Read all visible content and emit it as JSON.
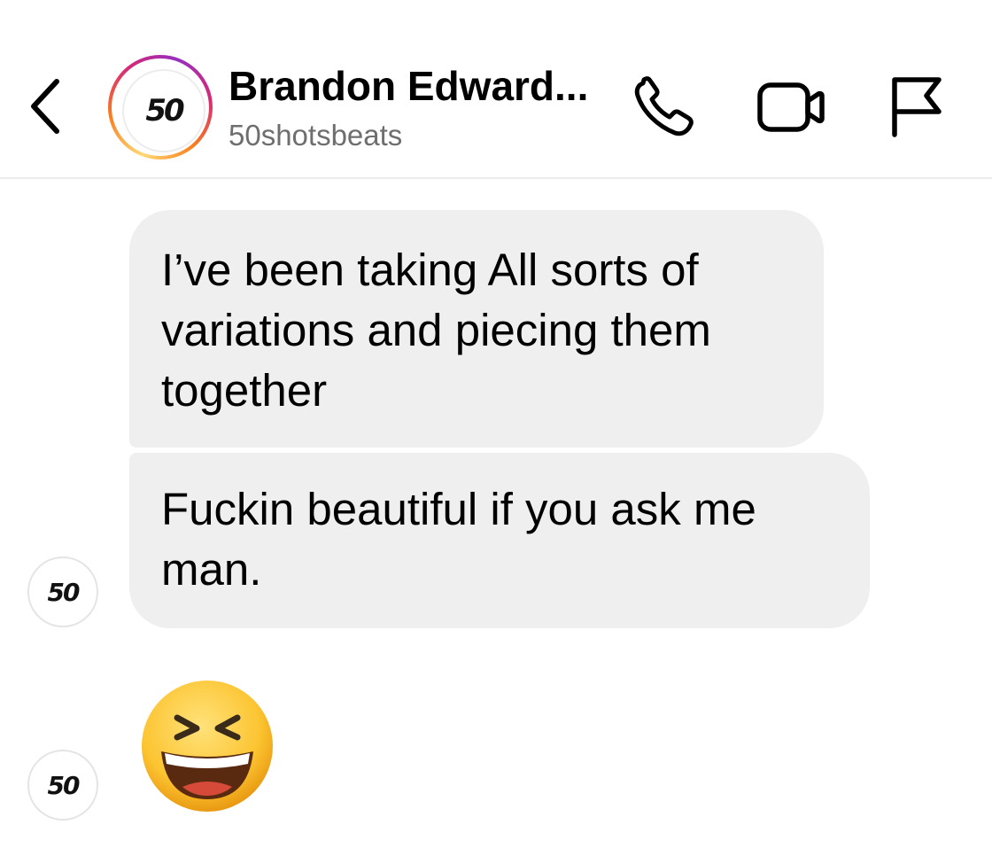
{
  "header": {
    "contact_name": "Brandon Edward...",
    "username": "50shotsbeats",
    "avatar_logo": "50",
    "icons": [
      "chevron-left-icon",
      "phone-icon",
      "video-camera-icon",
      "flag-icon"
    ]
  },
  "messages": [
    {
      "lines": [
        "I’ve been taking All sorts of",
        "variations and piecing them",
        "together"
      ]
    },
    {
      "lines": [
        "Fuckin beautiful if you ask me",
        "man."
      ]
    },
    {
      "emoji": "laughing-squinting-face-emoji"
    }
  ],
  "sender_avatar_logo": "50",
  "colors": {
    "bubble": "#efefef",
    "username": "#6e6e6e",
    "divider": "#ececec",
    "ring_gradient": [
      "#feda75",
      "#fa7e1e",
      "#d62976",
      "#962fbf"
    ]
  }
}
